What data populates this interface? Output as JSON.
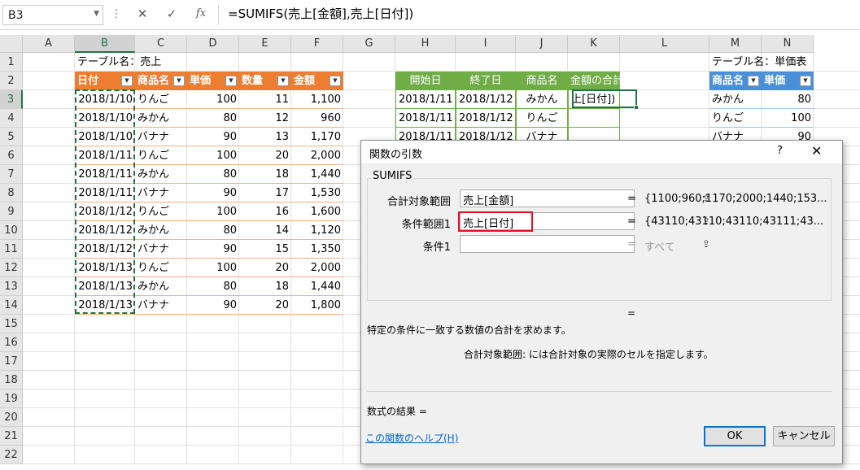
{
  "formula_bar": {
    "name_box": "B3",
    "formula": "=SUMIFS(売上[金額],売上[日付])",
    "icons": [
      "more-icon",
      "cancel-icon",
      "enter-icon",
      "function-icon"
    ]
  },
  "columns": [
    "A",
    "B",
    "C",
    "D",
    "E",
    "F",
    "G",
    "H",
    "I",
    "J",
    "K",
    "L",
    "M",
    "N"
  ],
  "rows": [
    "1",
    "2",
    "3",
    "4",
    "5",
    "6",
    "7",
    "8",
    "9",
    "10",
    "11",
    "12",
    "13",
    "14",
    "15",
    "16",
    "17",
    "18",
    "19",
    "20",
    "21",
    "22"
  ],
  "table1": {
    "caption": "テーブル名：売上",
    "headers": [
      "日付",
      "商品名",
      "単価",
      "数量",
      "金額"
    ],
    "rows": [
      [
        "2018/1/10",
        "りんご",
        "100",
        "11",
        "1,100"
      ],
      [
        "2018/1/10",
        "みかん",
        "80",
        "12",
        "960"
      ],
      [
        "2018/1/10",
        "バナナ",
        "90",
        "13",
        "1,170"
      ],
      [
        "2018/1/11",
        "りんご",
        "100",
        "20",
        "2,000"
      ],
      [
        "2018/1/11",
        "みかん",
        "80",
        "18",
        "1,440"
      ],
      [
        "2018/1/11",
        "バナナ",
        "90",
        "17",
        "1,530"
      ],
      [
        "2018/1/12",
        "りんご",
        "100",
        "16",
        "1,600"
      ],
      [
        "2018/1/12",
        "みかん",
        "80",
        "14",
        "1,120"
      ],
      [
        "2018/1/12",
        "バナナ",
        "90",
        "15",
        "1,350"
      ],
      [
        "2018/1/13",
        "りんご",
        "100",
        "20",
        "2,000"
      ],
      [
        "2018/1/13",
        "みかん",
        "80",
        "18",
        "1,440"
      ],
      [
        "2018/1/13",
        "バナナ",
        "90",
        "20",
        "1,800"
      ]
    ]
  },
  "table2": {
    "headers": [
      "開始日",
      "終了日",
      "商品名",
      "金額の合計"
    ],
    "rows": [
      [
        "2018/1/11",
        "2018/1/12",
        "みかん",
        "上[日付])"
      ],
      [
        "2018/1/11",
        "2018/1/12",
        "りんご",
        ""
      ],
      [
        "2018/1/11",
        "2018/1/12",
        "バナナ",
        ""
      ]
    ]
  },
  "table3": {
    "caption": "テーブル名：単価表",
    "headers": [
      "商品名",
      "単価"
    ],
    "rows": [
      [
        "みかん",
        "80"
      ],
      [
        "りんご",
        "100"
      ],
      [
        "バナナ",
        "90"
      ]
    ]
  },
  "dialog": {
    "title": "関数の引数",
    "help_btn": "?",
    "close_btn": "✕",
    "function_name": "SUMIFS",
    "args": [
      {
        "label": "合計対象範囲",
        "value": "売上[金額]",
        "result": "{1100;960;1170;2000;1440;153..."
      },
      {
        "label": "条件範囲1",
        "value": "売上[日付]",
        "result": "{43110;43110;43110;43111;43..."
      },
      {
        "label": "条件1",
        "value": "",
        "result": "すべて"
      }
    ],
    "eq": "=",
    "description": "特定の条件に一致する数値の合計を求めます。",
    "arg_help": "合計対象範囲:  には合計対象の実際のセルを指定します。",
    "formula_result": "数式の結果 =",
    "help_link": "この関数のヘルプ(H)",
    "ok": "OK",
    "cancel": "キャンセル"
  }
}
